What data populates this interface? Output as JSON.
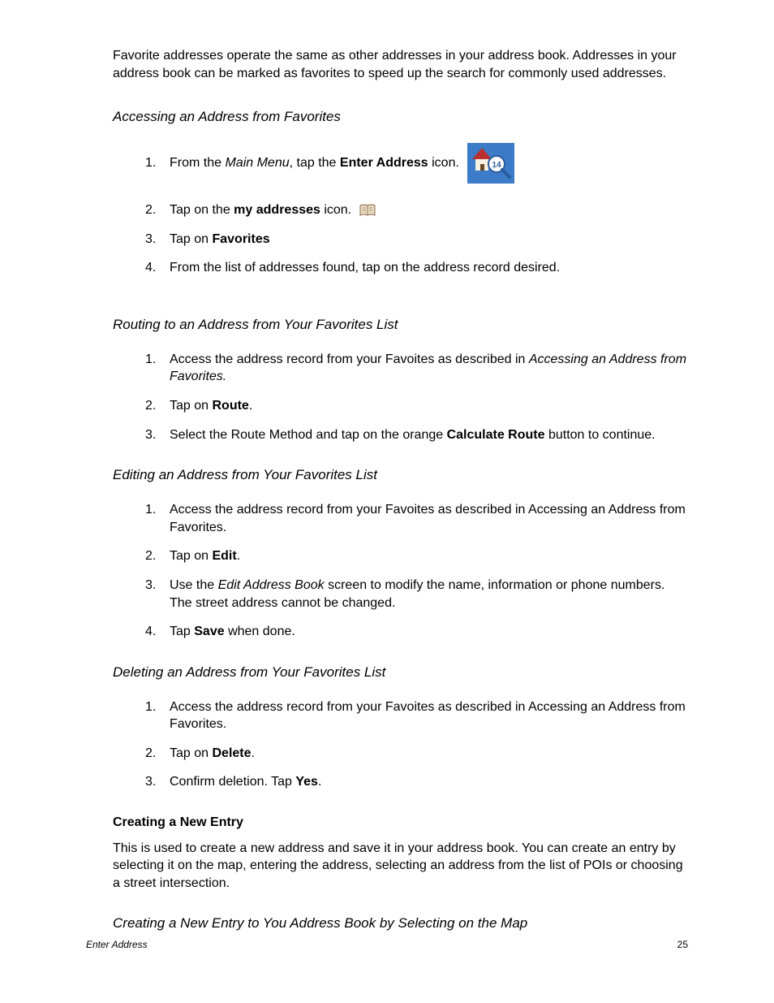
{
  "intro": "Favorite addresses operate the same as other addresses in your address book.  Addresses in your address book can be marked as favorites to speed up the search for commonly used addresses.",
  "s1": {
    "heading": "Accessing an Address from Favorites",
    "step1_a": "From the ",
    "step1_b": "Main Menu",
    "step1_c": ", tap the ",
    "step1_d": "Enter Address",
    "step1_e": " icon.",
    "step2_a": "Tap on the ",
    "step2_b": "my addresses",
    "step2_c": " icon.",
    "step3_a": "Tap on ",
    "step3_b": "Favorites",
    "step4": "From the list of addresses found, tap on the address record desired."
  },
  "s2": {
    "heading": "Routing to an Address from Your Favorites List",
    "step1_a": "Access the address record from your Favoites as described in ",
    "step1_b": "Accessing an Address from Favorites.",
    "step2_a": "Tap on ",
    "step2_b": "Route",
    "step2_c": ".",
    "step3_a": "Select the Route Method and tap on the orange ",
    "step3_b": "Calculate Route",
    "step3_c": " button to continue."
  },
  "s3": {
    "heading": "Editing an Address from Your Favorites List",
    "step1": "Access the address record from your Favoites as described in Accessing an Address from Favorites.",
    "step2_a": "Tap on ",
    "step2_b": "Edit",
    "step2_c": ".",
    "step3_a": "Use the ",
    "step3_b": "Edit Address Book",
    "step3_c": " screen to modify the name, information or phone numbers.  The street address cannot be changed.",
    "step4_a": "Tap ",
    "step4_b": "Save",
    "step4_c": " when done."
  },
  "s4": {
    "heading": "Deleting an Address from Your Favorites List",
    "step1": "Access the address record from your Favoites as described in Accessing an Address from Favorites.",
    "step2_a": "Tap on ",
    "step2_b": "Delete",
    "step2_c": ".",
    "step3_a": "Confirm deletion.  Tap ",
    "step3_b": "Yes",
    "step3_c": "."
  },
  "s5": {
    "heading": "Creating a New Entry",
    "para": "This is used to create a new address and save it in your address book.  You can create an entry by selecting it on the map, entering the address, selecting an address from the list of POIs or choosing a street intersection."
  },
  "s6": {
    "heading": "Creating a New Entry to You Address Book by Selecting on the Map"
  },
  "footer": {
    "left": "Enter Address",
    "right": "25"
  }
}
